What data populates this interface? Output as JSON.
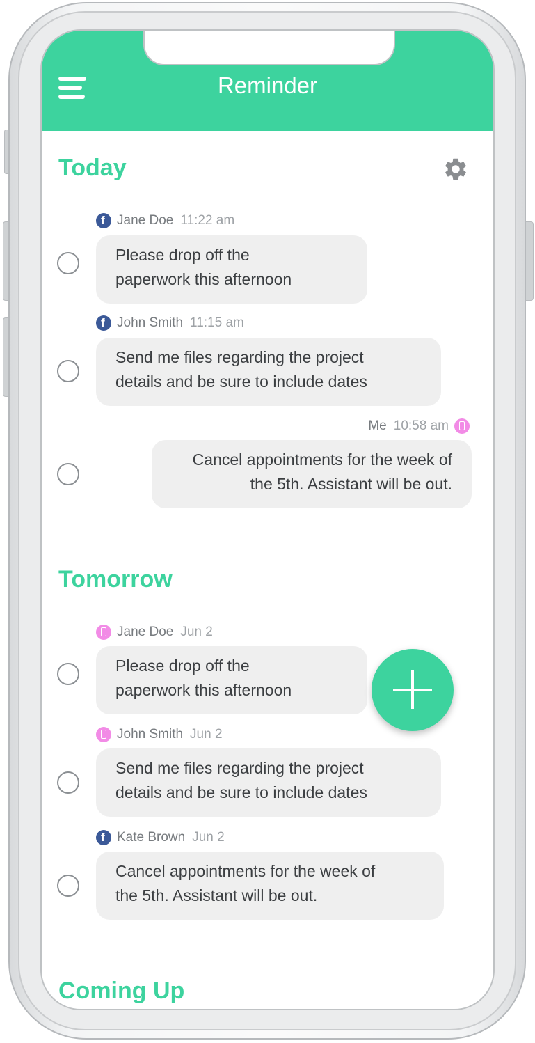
{
  "app": {
    "title": "Reminder",
    "accent": "#3dd39e"
  },
  "sections": {
    "today": "Today",
    "tomorrow": "Tomorrow",
    "coming_up": "Coming Up"
  },
  "today": [
    {
      "source": "facebook-icon",
      "sender": "Jane Doe",
      "time": "11:22 am",
      "line1": "Please drop off the",
      "line2": "paperwork this afternoon"
    },
    {
      "source": "facebook-icon",
      "sender": "John Smith",
      "time": "11:15 am",
      "line1": "Send me files regarding the project",
      "line2": "details and be sure to include dates"
    },
    {
      "source": "phone-icon",
      "sender": "Me",
      "time": "10:58 am",
      "line1": "Cancel appointments for the week of",
      "line2": "the 5th. Assistant will be out."
    }
  ],
  "tomorrow": [
    {
      "source": "phone-icon",
      "sender": "Jane Doe",
      "time": "Jun 2",
      "line1": "Please drop off the",
      "line2": "paperwork this afternoon"
    },
    {
      "source": "phone-icon",
      "sender": "John Smith",
      "time": "Jun 2",
      "line1": "Send me files regarding the project",
      "line2": "details and be sure to include dates"
    },
    {
      "source": "facebook-icon",
      "sender": "Kate Brown",
      "time": "Jun 2",
      "line1": "Cancel appointments for the week of",
      "line2": "the 5th. Assistant will be out."
    }
  ],
  "icons": {
    "menu": "menu-icon",
    "settings": "gear-icon",
    "add": "plus-icon"
  }
}
